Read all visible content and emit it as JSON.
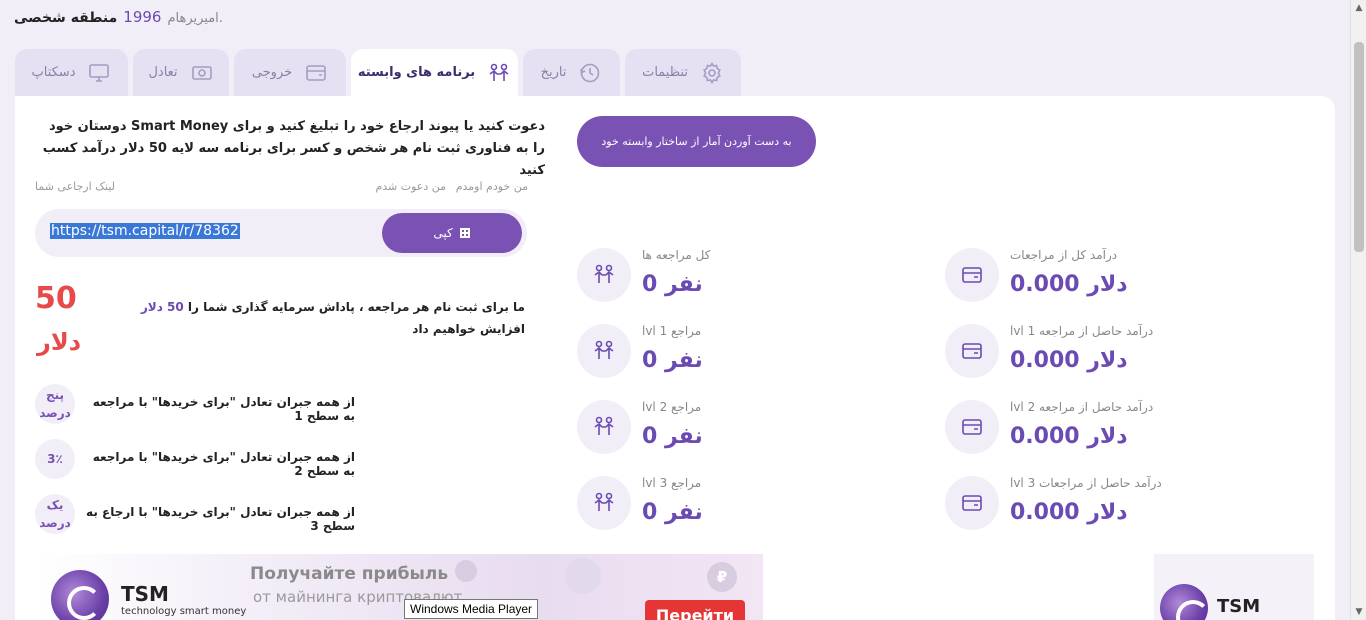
{
  "header": {
    "zone_label": "منطقه شخصی",
    "year": "1996",
    "username": "امیریرهام."
  },
  "tabs": [
    {
      "label": "دسکتاپ",
      "icon": "desktop-icon"
    },
    {
      "label": "تعادل",
      "icon": "money-icon"
    },
    {
      "label": "خروجی",
      "icon": "wallet-icon"
    },
    {
      "label": "برنامه های وابسته",
      "icon": "users-icon",
      "active": true
    },
    {
      "label": "تاریخ",
      "icon": "history-icon"
    },
    {
      "label": "تنظیمات",
      "icon": "gear-icon"
    }
  ],
  "affiliate": {
    "invite_text": "دعوت کنید یا پیوند ارجاع خود را تبلیغ کنید و برای Smart Money دوستان خود را به فناوری ثبت نام هر شخص و کسر برای برنامه سه لایه 50 دلار درآمد کسب کنید",
    "stats_button": "به دست آوردن آمار از ساختار وابسته خود",
    "who_invited": "من دعوت شدم",
    "self_came": "من خودم اومدم",
    "ref_link_label": "لینک ارجاعی شما",
    "ref_link": "https://tsm.capital/r/78362",
    "copy_label": "کپی",
    "bonus_value": "50",
    "bonus_unit": "دلار",
    "bonus_text_pre": "ما برای ثبت نام هر مراجعه ، پاداش سرمایه گذاری شما را",
    "bonus_text_highlight": "50 دلار",
    "bonus_text_post": "افزایش خواهیم داد",
    "levels": [
      {
        "badge": "پنج درصد",
        "text": "از همه جبران تعادل \"برای خریدها\" با مراجعه به سطح 1"
      },
      {
        "badge": "3٪",
        "text": "از همه جبران تعادل \"برای خریدها\" با مراجعه به سطح 2"
      },
      {
        "badge": "یک درصد",
        "text": "از همه جبران تعادل \"برای خریدها\" با ارجاع به سطح 3"
      }
    ]
  },
  "stats_people": [
    {
      "label": "کل مراجعه ها",
      "value": "نفر 0"
    },
    {
      "label": "lvl 1 مراجع",
      "value": "نفر 0"
    },
    {
      "label": "lvl 2 مراجع",
      "value": "نفر 0"
    },
    {
      "label": "lvl 3 مراجع",
      "value": "نفر 0"
    }
  ],
  "stats_income": [
    {
      "label": "درآمد کل از مراجعات",
      "value": "دلار 0.000"
    },
    {
      "label": "lvl 1 درآمد حاصل از مراجعه",
      "value": "دلار 0.000"
    },
    {
      "label": "lvl 2 درآمد حاصل از مراجعه",
      "value": "دلار 0.000"
    },
    {
      "label": "lvl 3 درآمد حاصل از مراجعات",
      "value": "دلار 0.000"
    }
  ],
  "banner": {
    "brand": "TSM",
    "brand_sub": "technology smart money",
    "line1": "Получайте прибыль",
    "line2": "от майнинга криптовалют",
    "button": "Перейти",
    "coin_symbol": "₽"
  },
  "tooltip": "Windows Media Player",
  "colors": {
    "accent": "#7a52b3",
    "bonus": "#e84a4a",
    "background": "#f1eef8"
  }
}
